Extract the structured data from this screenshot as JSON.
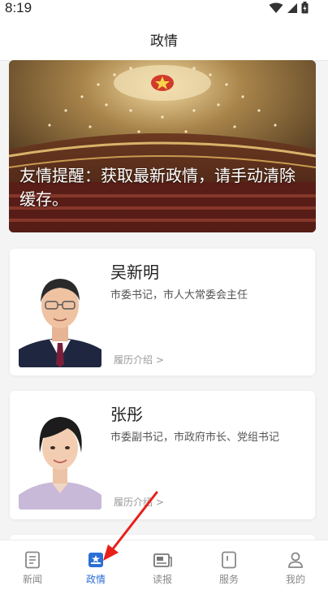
{
  "status_bar": {
    "time": "8:19"
  },
  "header": {
    "title": "政情"
  },
  "banner": {
    "text": "友情提醒：获取最新政情，请手动清除缓存。"
  },
  "leaders": [
    {
      "name": "吴新明",
      "title": "市委书记，市人大常委会主任",
      "link": "履历介绍 >"
    },
    {
      "name": "张彤",
      "title": "市委副书记，市政府市长、党组书记",
      "link": "履历介绍 >"
    }
  ],
  "tabs": [
    {
      "label": "新闻",
      "icon": "news-icon"
    },
    {
      "label": "政情",
      "icon": "politics-icon",
      "active": true
    },
    {
      "label": "读报",
      "icon": "newspaper-icon"
    },
    {
      "label": "服务",
      "icon": "service-icon"
    },
    {
      "label": "我的",
      "icon": "profile-icon"
    }
  ],
  "colors": {
    "accent": "#2b6fd6",
    "annotation_arrow": "#e8201a"
  }
}
